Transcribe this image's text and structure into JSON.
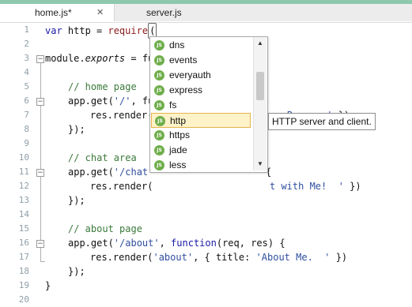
{
  "tabs": [
    {
      "label": "home.js*",
      "close": "✕",
      "active": true
    },
    {
      "label": "server.js",
      "active": false
    }
  ],
  "line_numbers": [
    "1",
    "2",
    "3",
    "4",
    "5",
    "6",
    "7",
    "8",
    "9",
    "10",
    "11",
    "12",
    "13",
    "14",
    "15",
    "16",
    "17",
    "18",
    "19",
    "20"
  ],
  "code": {
    "l1_kw": "var",
    "l1_rest": " http = ",
    "l1_fn": "require",
    "l1_paren": "(",
    "l3_a": "module.",
    "l3_b": "exports",
    "l3_c": " = fu",
    "l5": "// home page",
    "l6_a": "app.get(",
    "l6_str": "'/'",
    "l6_b": ", fu",
    "l7_a": "res.render(",
    "l7_b": "me Page.  '",
    "l7_c": " })",
    "l8": "});",
    "l10": "// chat area",
    "l11_a": "app.get(",
    "l11_str": "'/chat'",
    "l11_b": "{",
    "l12_a": "res.render(",
    "l12_b": "t with Me!  '",
    "l12_c": " })",
    "l13": "});",
    "l15": "// about page",
    "l16_a": "app.get(",
    "l16_str": "'/about'",
    "l16_b": ", ",
    "l16_kw": "function",
    "l16_c": "(req, res) {",
    "l17_a": "res.render(",
    "l17_str": "'about'",
    "l17_b": ", { title: ",
    "l17_str2": "'About Me.  '",
    "l17_c": " })",
    "l18": "});",
    "l19": "}"
  },
  "autocomplete": {
    "icon_text": "JS",
    "items": [
      "dns",
      "events",
      "everyauth",
      "express",
      "fs",
      "http",
      "https",
      "jade",
      "less"
    ],
    "selected": "http",
    "scroll_up": "▲",
    "scroll_down": "▼"
  },
  "tooltip": "HTTP server and client."
}
